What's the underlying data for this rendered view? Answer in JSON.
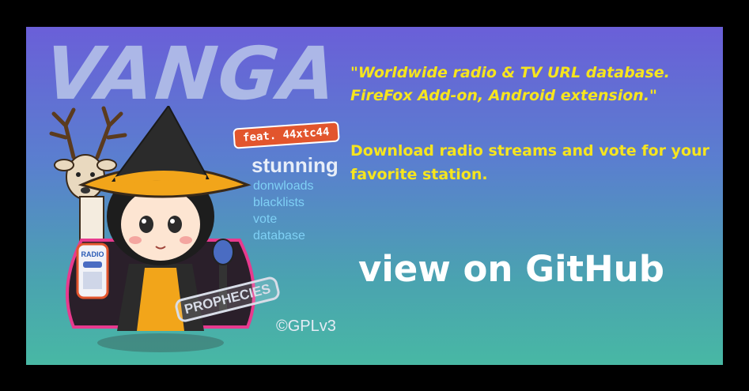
{
  "art": {
    "title": "VANGA",
    "feat": "feat. 44xtc44",
    "tagline": "stunning",
    "features": [
      "donwloads",
      "blacklists",
      "vote",
      "database"
    ],
    "stamp": "PROPHECIES",
    "radio_label": "RADIO",
    "license": "©GPLv3"
  },
  "text": {
    "quote_line1": "\"Worldwide radio & TV URL database.",
    "quote_line2": "FireFox Add-on, Android extension.\"",
    "description": "Download radio streams and vote for your favorite station.",
    "cta": "view on GitHub"
  },
  "colors": {
    "accent_text": "#f6e51e",
    "cta_text": "#ffffff",
    "feat_badge": "#e2552d"
  }
}
